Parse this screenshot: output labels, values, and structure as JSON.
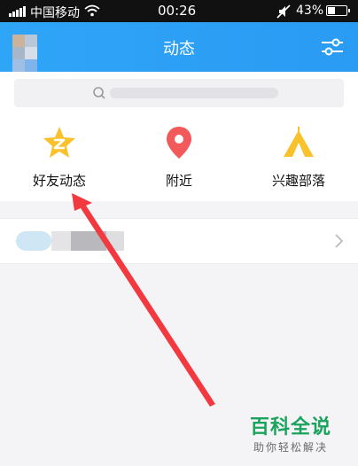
{
  "status_bar": {
    "carrier": "中国移动",
    "time": "00:26",
    "battery": "43%",
    "battery_level": 0.43,
    "icons": [
      "signal-icon",
      "wifi-icon",
      "mute-icon",
      "battery-icon"
    ]
  },
  "header": {
    "title": "动态",
    "settings_icon": "settings-sliders-icon"
  },
  "search": {
    "icon": "search-icon"
  },
  "entries": [
    {
      "label": "好友动态",
      "icon": "friends-star-icon",
      "color": "#f9c12c"
    },
    {
      "label": "附近",
      "icon": "location-pin-icon",
      "color": "#f2595a"
    },
    {
      "label": "兴趣部落",
      "icon": "tent-icon",
      "color": "#f9c12c"
    }
  ],
  "list": {
    "icon": "chevron-right-icon"
  },
  "annotation": {
    "color": "#f2393f"
  },
  "watermark": {
    "title": "百科全说",
    "subtitle": "助你轻松解决",
    "color": "#1aa35c"
  }
}
